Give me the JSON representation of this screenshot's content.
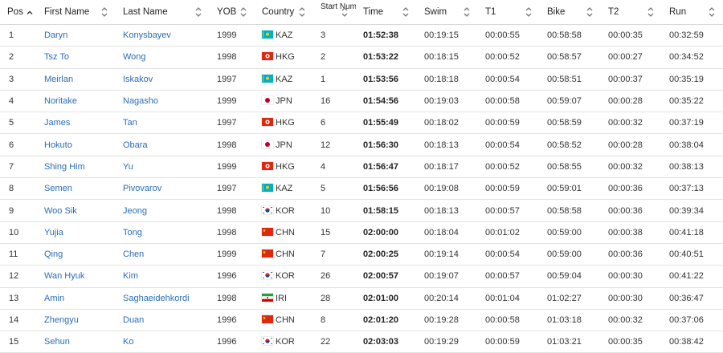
{
  "columns": [
    {
      "key": "pos",
      "label": "Pos",
      "sorted": "asc"
    },
    {
      "key": "first_name",
      "label": "First Name"
    },
    {
      "key": "last_name",
      "label": "Last Name"
    },
    {
      "key": "yob",
      "label": "YOB"
    },
    {
      "key": "country",
      "label": "Country"
    },
    {
      "key": "start_num",
      "label": "Start Num"
    },
    {
      "key": "time",
      "label": "Time"
    },
    {
      "key": "swim",
      "label": "Swim"
    },
    {
      "key": "t1",
      "label": "T1"
    },
    {
      "key": "bike",
      "label": "Bike"
    },
    {
      "key": "t2",
      "label": "T2"
    },
    {
      "key": "run",
      "label": "Run"
    }
  ],
  "rows": [
    {
      "pos": "1",
      "first_name": "Daryn",
      "last_name": "Konysbayev",
      "yob": "1999",
      "flag": "kaz-flag-icon",
      "country": "KAZ",
      "start_num": "3",
      "time": "01:52:38",
      "swim": "00:19:15",
      "t1": "00:00:55",
      "bike": "00:58:58",
      "t2": "00:00:35",
      "run": "00:32:59"
    },
    {
      "pos": "2",
      "first_name": "Tsz To",
      "last_name": "Wong",
      "yob": "1998",
      "flag": "hkg-flag-icon",
      "country": "HKG",
      "start_num": "2",
      "time": "01:53:22",
      "swim": "00:18:15",
      "t1": "00:00:52",
      "bike": "00:58:57",
      "t2": "00:00:27",
      "run": "00:34:52"
    },
    {
      "pos": "3",
      "first_name": "Meirlan",
      "last_name": "Iskakov",
      "yob": "1997",
      "flag": "kaz-flag-icon",
      "country": "KAZ",
      "start_num": "1",
      "time": "01:53:56",
      "swim": "00:18:18",
      "t1": "00:00:54",
      "bike": "00:58:51",
      "t2": "00:00:37",
      "run": "00:35:19"
    },
    {
      "pos": "4",
      "first_name": "Noritake",
      "last_name": "Nagasho",
      "yob": "1999",
      "flag": "jpn-flag-icon",
      "country": "JPN",
      "start_num": "16",
      "time": "01:54:56",
      "swim": "00:19:03",
      "t1": "00:00:58",
      "bike": "00:59:07",
      "t2": "00:00:28",
      "run": "00:35:22"
    },
    {
      "pos": "5",
      "first_name": "James",
      "last_name": "Tan",
      "yob": "1997",
      "flag": "hkg-flag-icon",
      "country": "HKG",
      "start_num": "6",
      "time": "01:55:49",
      "swim": "00:18:02",
      "t1": "00:00:59",
      "bike": "00:58:59",
      "t2": "00:00:32",
      "run": "00:37:19"
    },
    {
      "pos": "6",
      "first_name": "Hokuto",
      "last_name": "Obara",
      "yob": "1998",
      "flag": "jpn-flag-icon",
      "country": "JPN",
      "start_num": "12",
      "time": "01:56:30",
      "swim": "00:18:13",
      "t1": "00:00:54",
      "bike": "00:58:52",
      "t2": "00:00:28",
      "run": "00:38:04"
    },
    {
      "pos": "7",
      "first_name": "Shing Him",
      "last_name": "Yu",
      "yob": "1999",
      "flag": "hkg-flag-icon",
      "country": "HKG",
      "start_num": "4",
      "time": "01:56:47",
      "swim": "00:18:17",
      "t1": "00:00:52",
      "bike": "00:58:55",
      "t2": "00:00:32",
      "run": "00:38:13"
    },
    {
      "pos": "8",
      "first_name": "Semen",
      "last_name": "Pivovarov",
      "yob": "1997",
      "flag": "kaz-flag-icon",
      "country": "KAZ",
      "start_num": "5",
      "time": "01:56:56",
      "swim": "00:19:08",
      "t1": "00:00:59",
      "bike": "00:59:01",
      "t2": "00:00:36",
      "run": "00:37:13"
    },
    {
      "pos": "9",
      "first_name": "Woo Sik",
      "last_name": "Jeong",
      "yob": "1998",
      "flag": "kor-flag-icon",
      "country": "KOR",
      "start_num": "10",
      "time": "01:58:15",
      "swim": "00:18:13",
      "t1": "00:00:57",
      "bike": "00:58:58",
      "t2": "00:00:36",
      "run": "00:39:34"
    },
    {
      "pos": "10",
      "first_name": "Yujia",
      "last_name": "Tong",
      "yob": "1998",
      "flag": "chn-flag-icon",
      "country": "CHN",
      "start_num": "15",
      "time": "02:00:00",
      "swim": "00:18:04",
      "t1": "00:01:02",
      "bike": "00:59:00",
      "t2": "00:00:38",
      "run": "00:41:18"
    },
    {
      "pos": "11",
      "first_name": "Qing",
      "last_name": "Chen",
      "yob": "1999",
      "flag": "chn-flag-icon",
      "country": "CHN",
      "start_num": "7",
      "time": "02:00:25",
      "swim": "00:19:14",
      "t1": "00:00:54",
      "bike": "00:59:00",
      "t2": "00:00:36",
      "run": "00:40:51"
    },
    {
      "pos": "12",
      "first_name": "Wan Hyuk",
      "last_name": "Kim",
      "yob": "1996",
      "flag": "kor-flag-icon",
      "country": "KOR",
      "start_num": "26",
      "time": "02:00:57",
      "swim": "00:19:07",
      "t1": "00:00:57",
      "bike": "00:59:04",
      "t2": "00:00:30",
      "run": "00:41:22"
    },
    {
      "pos": "13",
      "first_name": "Amin",
      "last_name": "Saghaeidehkordi",
      "yob": "1998",
      "flag": "iri-flag-icon",
      "country": "IRI",
      "start_num": "28",
      "time": "02:01:00",
      "swim": "00:20:14",
      "t1": "00:01:04",
      "bike": "01:02:27",
      "t2": "00:00:30",
      "run": "00:36:47"
    },
    {
      "pos": "14",
      "first_name": "Zhengyu",
      "last_name": "Duan",
      "yob": "1996",
      "flag": "chn-flag-icon",
      "country": "CHN",
      "start_num": "8",
      "time": "02:01:20",
      "swim": "00:19:28",
      "t1": "00:00:58",
      "bike": "01:03:18",
      "t2": "00:00:32",
      "run": "00:37:06"
    },
    {
      "pos": "15",
      "first_name": "Sehun",
      "last_name": "Ko",
      "yob": "1996",
      "flag": "kor-flag-icon",
      "country": "KOR",
      "start_num": "22",
      "time": "02:03:03",
      "swim": "00:19:29",
      "t1": "00:00:59",
      "bike": "01:03:21",
      "t2": "00:00:35",
      "run": "00:38:42"
    }
  ]
}
